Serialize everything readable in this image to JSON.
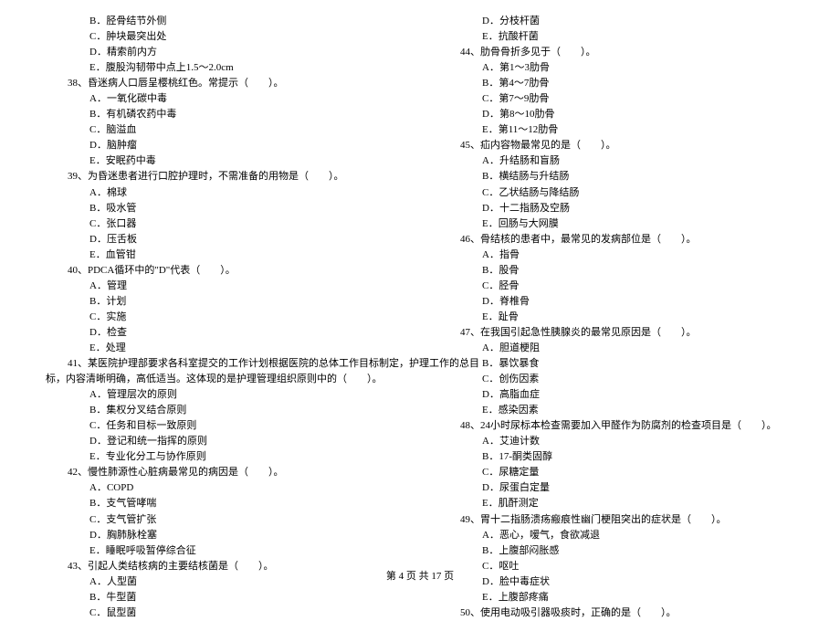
{
  "left": {
    "pre": [
      "B．胫骨结节外侧",
      "C．肿块最突出处",
      "D．精索前内方",
      "E．腹股沟韧带中点上1.5～2.0cm"
    ],
    "q38": {
      "stem": "38、昏迷病人口唇呈樱桃红色。常提示（　　）。",
      "opts": [
        "A．一氧化碳中毒",
        "B．有机磷农药中毒",
        "C．脑溢血",
        "D．脑肿瘤",
        "E．安眠药中毒"
      ]
    },
    "q39": {
      "stem": "39、为昏迷患者进行口腔护理时，不需准备的用物是（　　）。",
      "opts": [
        "A．棉球",
        "B．吸水管",
        "C．张口器",
        "D．压舌板",
        "E．血管钳"
      ]
    },
    "q40": {
      "stem": "40、PDCA循环中的\"D\"代表（　　）。",
      "opts": [
        "A．管理",
        "B．计划",
        "C．实施",
        "D．检查",
        "E．处理"
      ]
    },
    "q41": {
      "stem1": "41、某医院护理部要求各科室提交的工作计划根据医院的总体工作目标制定，护理工作的总目",
      "stem2": "标，内容清晰明确，高低适当。这体现的是护理管理组织原则中的（　　）。",
      "opts": [
        "A．管理层次的原则",
        "B．集权分叉结合原则",
        "C．任务和目标一致原则",
        "D．登记和统一指挥的原则",
        "E．专业化分工与协作原则"
      ]
    },
    "q42": {
      "stem": "42、慢性肺源性心脏病最常见的病因是（　　）。",
      "opts": [
        "A．COPD",
        "B．支气管哮喘",
        "C．支气管扩张",
        "D．胸肺脉栓塞",
        "E．睡眠呼吸暂停综合征"
      ]
    },
    "q43": {
      "stem": "43、引起人类结核病的主要结核菌是（　　）。",
      "opts": [
        "A．人型菌",
        "B．牛型菌",
        "C．鼠型菌"
      ]
    }
  },
  "right": {
    "pre": [
      "D．分枝杆菌",
      "E．抗酸杆菌"
    ],
    "q44": {
      "stem": "44、肋骨骨折多见于（　　）。",
      "opts": [
        "A．第1～3肋骨",
        "B．第4～7肋骨",
        "C．第7～9肋骨",
        "D．第8～10肋骨",
        "E．第11～12肋骨"
      ]
    },
    "q45": {
      "stem": "45、疝内容物最常见的是（　　）。",
      "opts": [
        "A．升结肠和盲肠",
        "B．横结肠与升结肠",
        "C．乙状结肠与降结肠",
        "D．十二指肠及空肠",
        "E．回肠与大网膜"
      ]
    },
    "q46": {
      "stem": "46、骨结核的患者中，最常见的发病部位是（　　）。",
      "opts": [
        "A．指骨",
        "B．股骨",
        "C．胫骨",
        "D．脊椎骨",
        "E．趾骨"
      ]
    },
    "q47": {
      "stem": "47、在我国引起急性胰腺炎的最常见原因是（　　）。",
      "opts": [
        "A．胆道梗阻",
        "B．暴饮暴食",
        "C．创伤因素",
        "D．高脂血症",
        "E．感染因素"
      ]
    },
    "q48": {
      "stem": "48、24小时尿标本检查需要加入甲醛作为防腐剂的检查项目是（　　）。",
      "opts": [
        "A．艾迪计数",
        "B．17-酮类固醇",
        "C．尿糖定量",
        "D．尿蛋白定量",
        "E．肌酐测定"
      ]
    },
    "q49": {
      "stem": "49、胃十二指肠溃疡瘢痕性幽门梗阻突出的症状是（　　）。",
      "opts": [
        "A．恶心，嗳气，食欲减退",
        "B．上腹部闷胀感",
        "C．呕吐",
        "D．脸中毒症状",
        "E．上腹部疼痛"
      ]
    },
    "q50": {
      "stem": "50、使用电动吸引器吸痰时，正确的是（　　）。"
    }
  },
  "footer": "第 4 页 共 17 页"
}
